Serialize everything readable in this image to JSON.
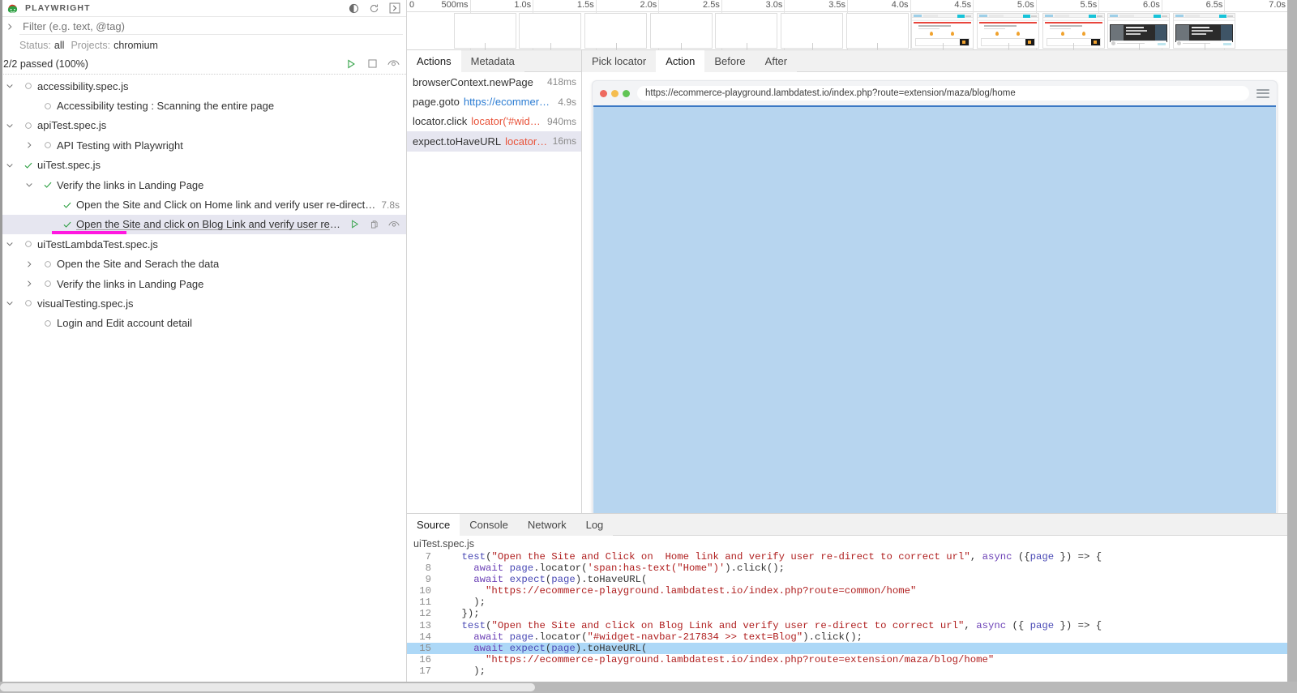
{
  "app": {
    "title": "PLAYWRIGHT"
  },
  "header_icons": [
    {
      "name": "theme-toggle-icon",
      "label": "toggle-dark-mode"
    },
    {
      "name": "reload-icon",
      "label": "reload"
    },
    {
      "name": "expand-panel-icon",
      "label": "toggle-sidebar"
    }
  ],
  "filter": {
    "placeholder": "Filter (e.g. text, @tag)",
    "value": ""
  },
  "status_line": {
    "status_label": "Status:",
    "status_value": "all",
    "projects_label": "Projects:",
    "projects_value": "chromium"
  },
  "summary": {
    "text": "2/2 passed (100%)",
    "actions": [
      {
        "name": "run-all-button",
        "icon": "play-icon"
      },
      {
        "name": "stop-button",
        "icon": "stop-icon"
      },
      {
        "name": "watch-button",
        "icon": "eye-icon"
      }
    ]
  },
  "tree": [
    {
      "indent": 0,
      "chevron": "down",
      "status": "none",
      "label": "accessibility.spec.js",
      "duration": "",
      "selected": false
    },
    {
      "indent": 1,
      "chevron": "none",
      "status": "none",
      "label": "Accessibility testing : Scanning the entire page",
      "duration": "",
      "selected": false
    },
    {
      "indent": 0,
      "chevron": "down",
      "status": "none",
      "label": "apiTest.spec.js",
      "duration": "",
      "selected": false
    },
    {
      "indent": 1,
      "chevron": "right",
      "status": "none",
      "label": "API Testing with Playwright",
      "duration": "",
      "selected": false
    },
    {
      "indent": 0,
      "chevron": "down",
      "status": "passed",
      "label": "uiTest.spec.js",
      "duration": "",
      "selected": false
    },
    {
      "indent": 1,
      "chevron": "down",
      "status": "passed",
      "label": "Verify the links in Landing Page",
      "duration": "",
      "selected": false
    },
    {
      "indent": 2,
      "chevron": "none",
      "status": "passed",
      "label": "Open the Site and Click on Home link and verify user re-direct to correct url",
      "duration": "7.8s",
      "selected": false
    },
    {
      "indent": 2,
      "chevron": "none",
      "status": "passed",
      "label": "Open the Site and click on Blog Link and verify user re-direct to cor…",
      "duration": "",
      "selected": true,
      "underline": true,
      "annotated": true,
      "row_icons": [
        {
          "name": "run-test-button",
          "icon": "play-icon"
        },
        {
          "name": "copy-button",
          "icon": "copy-icon"
        },
        {
          "name": "watch-test-button",
          "icon": "eye-icon"
        }
      ]
    },
    {
      "indent": 0,
      "chevron": "down",
      "status": "none",
      "label": "uiTestLambdaTest.spec.js",
      "duration": "",
      "selected": false
    },
    {
      "indent": 1,
      "chevron": "right",
      "status": "none",
      "label": "Open the Site and Serach the data",
      "duration": "",
      "selected": false
    },
    {
      "indent": 1,
      "chevron": "right",
      "status": "none",
      "label": "Verify the links in Landing Page",
      "duration": "",
      "selected": false
    },
    {
      "indent": 0,
      "chevron": "down",
      "status": "none",
      "label": "visualTesting.spec.js",
      "duration": "",
      "selected": false
    },
    {
      "indent": 1,
      "chevron": "none",
      "status": "none",
      "label": "Login and Edit account detail",
      "duration": "",
      "selected": false
    }
  ],
  "timeline": {
    "zero_label": "0",
    "ticks": [
      "500ms",
      "1.0s",
      "1.5s",
      "2.0s",
      "2.5s",
      "3.0s",
      "3.5s",
      "4.0s",
      "4.5s",
      "5.0s",
      "5.5s",
      "6.0s",
      "6.5s",
      "7.0s"
    ],
    "total_seconds": 7.0,
    "filmstrip": [
      {
        "at": 0.62,
        "kind": "blank"
      },
      {
        "at": 1.14,
        "kind": "blank"
      },
      {
        "at": 1.66,
        "kind": "blank"
      },
      {
        "at": 2.18,
        "kind": "blank"
      },
      {
        "at": 2.7,
        "kind": "blank"
      },
      {
        "at": 3.22,
        "kind": "blank"
      },
      {
        "at": 3.74,
        "kind": "blank"
      },
      {
        "at": 4.26,
        "kind": "page"
      },
      {
        "at": 4.78,
        "kind": "page"
      },
      {
        "at": 5.3,
        "kind": "page"
      },
      {
        "at": 5.82,
        "kind": "blog"
      },
      {
        "at": 6.34,
        "kind": "blog"
      }
    ]
  },
  "popout": {
    "name": "open-in-new-window-icon"
  },
  "actions_panel": {
    "tabs": [
      {
        "label": "Actions",
        "active": true
      },
      {
        "label": "Metadata",
        "active": false
      }
    ],
    "rows": [
      {
        "title": "browserContext.newPage",
        "param": "",
        "param_kind": "none",
        "duration": "418ms",
        "selected": false
      },
      {
        "title": "page.goto",
        "param": "https://ecommerce-pl…",
        "param_kind": "url",
        "duration": "4.9s",
        "selected": false
      },
      {
        "title": "locator.click",
        "param": "locator('#widget…",
        "param_kind": "selector",
        "duration": "940ms",
        "selected": false
      },
      {
        "title": "expect.toHaveURL",
        "param": "locator(':roo…",
        "param_kind": "selector",
        "duration": "16ms",
        "selected": true
      }
    ]
  },
  "preview": {
    "tabs": [
      {
        "label": "Pick locator",
        "active": false
      },
      {
        "label": "Action",
        "active": true
      },
      {
        "label": "Before",
        "active": false
      },
      {
        "label": "After",
        "active": false
      }
    ],
    "browser": {
      "url": "https://ecommerce-playground.lambdatest.io/index.php?route=extension/maza/blog/home",
      "traffic_lights": [
        "#ee6a5f",
        "#f5bd4f",
        "#61c454"
      ],
      "menu_icon": "hamburger-menu-icon",
      "viewport_color": "#b7d5ef"
    }
  },
  "bottom_panel": {
    "tabs": [
      {
        "label": "Source",
        "active": true
      },
      {
        "label": "Console",
        "active": false
      },
      {
        "label": "Network",
        "active": false
      },
      {
        "label": "Log",
        "active": false
      }
    ],
    "source_file": "uiTest.spec.js",
    "code_lines": [
      {
        "no": "7",
        "highlighted": false,
        "tokens": [
          {
            "t": "    ",
            "c": ""
          },
          {
            "t": "test",
            "c": "k-var"
          },
          {
            "t": "(",
            "c": ""
          },
          {
            "t": "\"Open the Site and Click on  Home link and verify user re-direct to correct url\"",
            "c": "k-str"
          },
          {
            "t": ", ",
            "c": ""
          },
          {
            "t": "async",
            "c": "k-async"
          },
          {
            "t": " ({",
            "c": ""
          },
          {
            "t": "page",
            "c": "k-var"
          },
          {
            "t": " }) => {",
            "c": ""
          }
        ]
      },
      {
        "no": "8",
        "highlighted": false,
        "tokens": [
          {
            "t": "      ",
            "c": ""
          },
          {
            "t": "await",
            "c": "k-async"
          },
          {
            "t": " ",
            "c": ""
          },
          {
            "t": "page",
            "c": "k-var"
          },
          {
            "t": ".locator(",
            "c": ""
          },
          {
            "t": "'span:has-text(\"Home\")'",
            "c": "k-str"
          },
          {
            "t": ").click();",
            "c": ""
          }
        ]
      },
      {
        "no": "9",
        "highlighted": false,
        "tokens": [
          {
            "t": "      ",
            "c": ""
          },
          {
            "t": "await",
            "c": "k-async"
          },
          {
            "t": " ",
            "c": ""
          },
          {
            "t": "expect",
            "c": "k-var"
          },
          {
            "t": "(",
            "c": ""
          },
          {
            "t": "page",
            "c": "k-var"
          },
          {
            "t": ").toHaveURL(",
            "c": ""
          }
        ]
      },
      {
        "no": "10",
        "highlighted": false,
        "tokens": [
          {
            "t": "        ",
            "c": ""
          },
          {
            "t": "\"https://ecommerce-playground.lambdatest.io/index.php?route=common/home\"",
            "c": "k-str"
          }
        ]
      },
      {
        "no": "11",
        "highlighted": false,
        "tokens": [
          {
            "t": "      );",
            "c": ""
          }
        ]
      },
      {
        "no": "12",
        "highlighted": false,
        "tokens": [
          {
            "t": "    });",
            "c": ""
          }
        ]
      },
      {
        "no": "13",
        "highlighted": false,
        "tokens": [
          {
            "t": "    ",
            "c": ""
          },
          {
            "t": "test",
            "c": "k-var"
          },
          {
            "t": "(",
            "c": ""
          },
          {
            "t": "\"Open the Site and click on Blog Link and verify user re-direct to correct url\"",
            "c": "k-str"
          },
          {
            "t": ", ",
            "c": ""
          },
          {
            "t": "async",
            "c": "k-async"
          },
          {
            "t": " ({ ",
            "c": ""
          },
          {
            "t": "page",
            "c": "k-var"
          },
          {
            "t": " }) => {",
            "c": ""
          }
        ]
      },
      {
        "no": "14",
        "highlighted": false,
        "tokens": [
          {
            "t": "      ",
            "c": ""
          },
          {
            "t": "await",
            "c": "k-async"
          },
          {
            "t": " ",
            "c": ""
          },
          {
            "t": "page",
            "c": "k-var"
          },
          {
            "t": ".locator(",
            "c": ""
          },
          {
            "t": "\"#widget-navbar-217834 >> text=Blog\"",
            "c": "k-str"
          },
          {
            "t": ").click();",
            "c": ""
          }
        ]
      },
      {
        "no": "15",
        "highlighted": true,
        "tokens": [
          {
            "t": "      ",
            "c": ""
          },
          {
            "t": "await",
            "c": "k-async"
          },
          {
            "t": " ",
            "c": ""
          },
          {
            "t": "expect",
            "c": "k-var"
          },
          {
            "t": "(",
            "c": ""
          },
          {
            "t": "page",
            "c": "k-var"
          },
          {
            "t": ").toHaveURL(",
            "c": ""
          }
        ]
      },
      {
        "no": "16",
        "highlighted": false,
        "tokens": [
          {
            "t": "        ",
            "c": ""
          },
          {
            "t": "\"https://ecommerce-playground.lambdatest.io/index.php?route=extension/maza/blog/home\"",
            "c": "k-str"
          }
        ]
      },
      {
        "no": "17",
        "highlighted": false,
        "tokens": [
          {
            "t": "      );",
            "c": ""
          }
        ]
      }
    ]
  }
}
